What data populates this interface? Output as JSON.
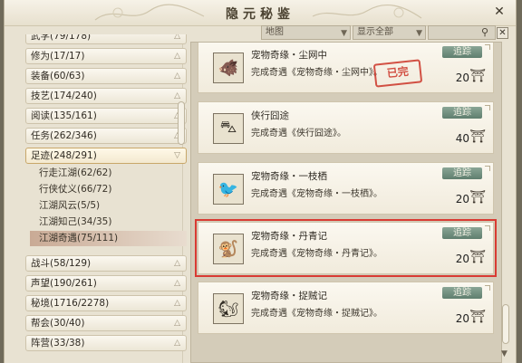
{
  "window": {
    "title": "隐元秘鉴",
    "close_label": "✕"
  },
  "filters": {
    "map": {
      "value": "地图"
    },
    "display": {
      "value": "显示全部"
    },
    "search": {
      "placeholder": ""
    },
    "clear_label": "✕"
  },
  "categories": [
    {
      "label": "武学(79/178)"
    },
    {
      "label": "修为(17/17)"
    },
    {
      "label": "装备(60/63)"
    },
    {
      "label": "技艺(174/240)"
    },
    {
      "label": "阅读(135/161)"
    },
    {
      "label": "任务(262/346)"
    },
    {
      "label": "足迹(248/291)",
      "open": true
    },
    {
      "label": "战斗(58/129)"
    },
    {
      "label": "声望(190/261)"
    },
    {
      "label": "秘境(1716/2278)"
    },
    {
      "label": "帮会(30/40)"
    },
    {
      "label": "阵营(33/38)"
    }
  ],
  "subcategories": [
    {
      "label": "行走江湖(62/62)"
    },
    {
      "label": "行侠仗义(66/72)"
    },
    {
      "label": "江湖风云(5/5)"
    },
    {
      "label": "江湖知己(34/35)"
    },
    {
      "label": "江湖奇遇(75/111)",
      "selected": true
    }
  ],
  "achievements": [
    {
      "title": "宠物奇缘・尘网中",
      "desc": "完成奇遇《宠物奇缘・尘网中》。",
      "track": "追踪",
      "points": "20",
      "icon": "boar-icon",
      "stamp": "已完"
    },
    {
      "title": "侠行囧途",
      "desc": "完成奇遇《侠行囧途》。",
      "track": "追踪",
      "points": "40",
      "icon": "cart-icon"
    },
    {
      "title": "宠物奇缘・一枝栖",
      "desc": "完成奇遇《宠物奇缘・一枝栖》。",
      "track": "追踪",
      "points": "20",
      "icon": "bird-icon"
    },
    {
      "title": "宠物奇缘・丹青记",
      "desc": "完成奇遇《宠物奇缘・丹青记》。",
      "track": "追踪",
      "points": "20",
      "icon": "monkey-icon",
      "highlighted": true
    },
    {
      "title": "宠物奇缘・捉贼记",
      "desc": "完成奇遇《宠物奇缘・捉贼记》。",
      "track": "追踪",
      "points": "20",
      "icon": "squirrel-icon"
    }
  ],
  "colors": {
    "accent_green": "#6d8b7b",
    "highlight_red": "#d93b33"
  }
}
